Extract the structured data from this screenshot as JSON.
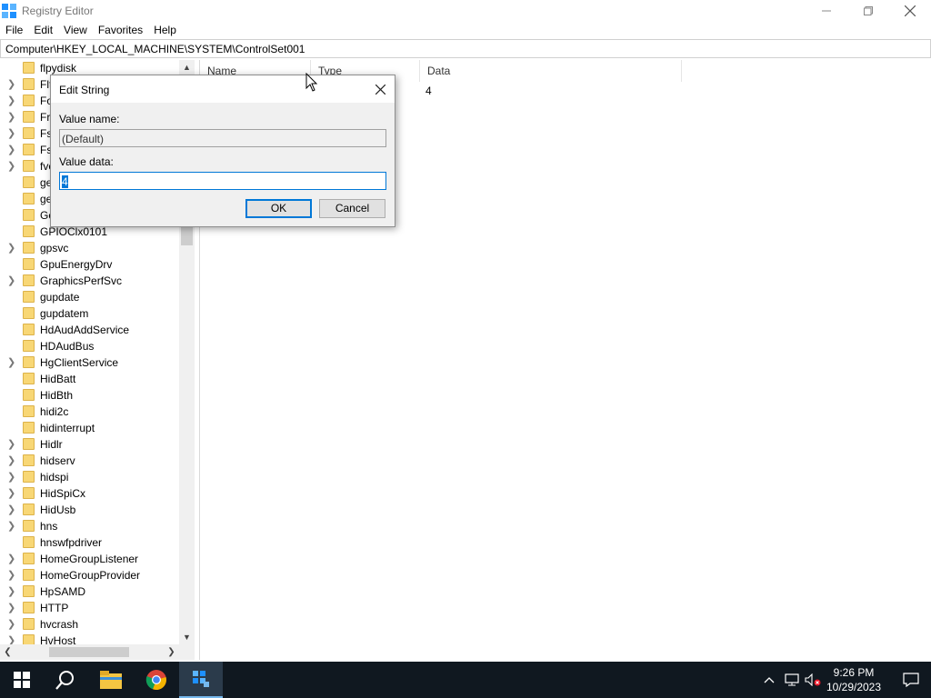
{
  "window": {
    "title": "Registry Editor",
    "minimize": "—",
    "maximize": "❐",
    "close": "✕"
  },
  "menu": [
    "File",
    "Edit",
    "View",
    "Favorites",
    "Help"
  ],
  "address": "Computer\\HKEY_LOCAL_MACHINE\\SYSTEM\\ControlSet001",
  "tree": {
    "items": [
      {
        "label": "flpydisk",
        "expandable": false
      },
      {
        "label": "FltMgr",
        "expandable": true
      },
      {
        "label": "FontCache",
        "expandable": true
      },
      {
        "label": "FrameServer",
        "expandable": true
      },
      {
        "label": "FsDepends",
        "expandable": true
      },
      {
        "label": "Fs_Rec",
        "expandable": true
      },
      {
        "label": "fvevol",
        "expandable": true
      },
      {
        "label": "gencounter",
        "expandable": false
      },
      {
        "label": "genericusbfn",
        "expandable": false
      },
      {
        "label": "GoogleChromeElevationService",
        "expandable": false
      },
      {
        "label": "GPIOClx0101",
        "expandable": false
      },
      {
        "label": "gpsvc",
        "expandable": true
      },
      {
        "label": "GpuEnergyDrv",
        "expandable": false
      },
      {
        "label": "GraphicsPerfSvc",
        "expandable": true
      },
      {
        "label": "gupdate",
        "expandable": false
      },
      {
        "label": "gupdatem",
        "expandable": false
      },
      {
        "label": "HdAudAddService",
        "expandable": false
      },
      {
        "label": "HDAudBus",
        "expandable": false
      },
      {
        "label": "HgClientService",
        "expandable": true
      },
      {
        "label": "HidBatt",
        "expandable": false
      },
      {
        "label": "HidBth",
        "expandable": false
      },
      {
        "label": "hidi2c",
        "expandable": false
      },
      {
        "label": "hidinterrupt",
        "expandable": false
      },
      {
        "label": "Hidlr",
        "expandable": true
      },
      {
        "label": "hidserv",
        "expandable": true
      },
      {
        "label": "hidspi",
        "expandable": true
      },
      {
        "label": "HidSpiCx",
        "expandable": true
      },
      {
        "label": "HidUsb",
        "expandable": true
      },
      {
        "label": "hns",
        "expandable": true
      },
      {
        "label": "hnswfpdriver",
        "expandable": false
      },
      {
        "label": "HomeGroupListener",
        "expandable": true
      },
      {
        "label": "HomeGroupProvider",
        "expandable": true
      },
      {
        "label": "HpSAMD",
        "expandable": true
      },
      {
        "label": "HTTP",
        "expandable": true
      },
      {
        "label": "hvcrash",
        "expandable": true
      },
      {
        "label": "HvHost",
        "expandable": true
      }
    ]
  },
  "list": {
    "columns": [
      "Name",
      "Type",
      "Data"
    ],
    "rows": [
      {
        "data": "4"
      }
    ]
  },
  "dialog": {
    "title": "Edit String",
    "value_name_label": "Value name:",
    "value_name": "(Default)",
    "value_data_label": "Value data:",
    "value_data": "4",
    "ok_label": "OK",
    "cancel_label": "Cancel"
  },
  "taskbar": {
    "time": "9:26 PM",
    "date": "10/29/2023"
  },
  "colors": {
    "accent": "#0078d7",
    "taskbar": "#101820",
    "folder": "#f8d775"
  }
}
